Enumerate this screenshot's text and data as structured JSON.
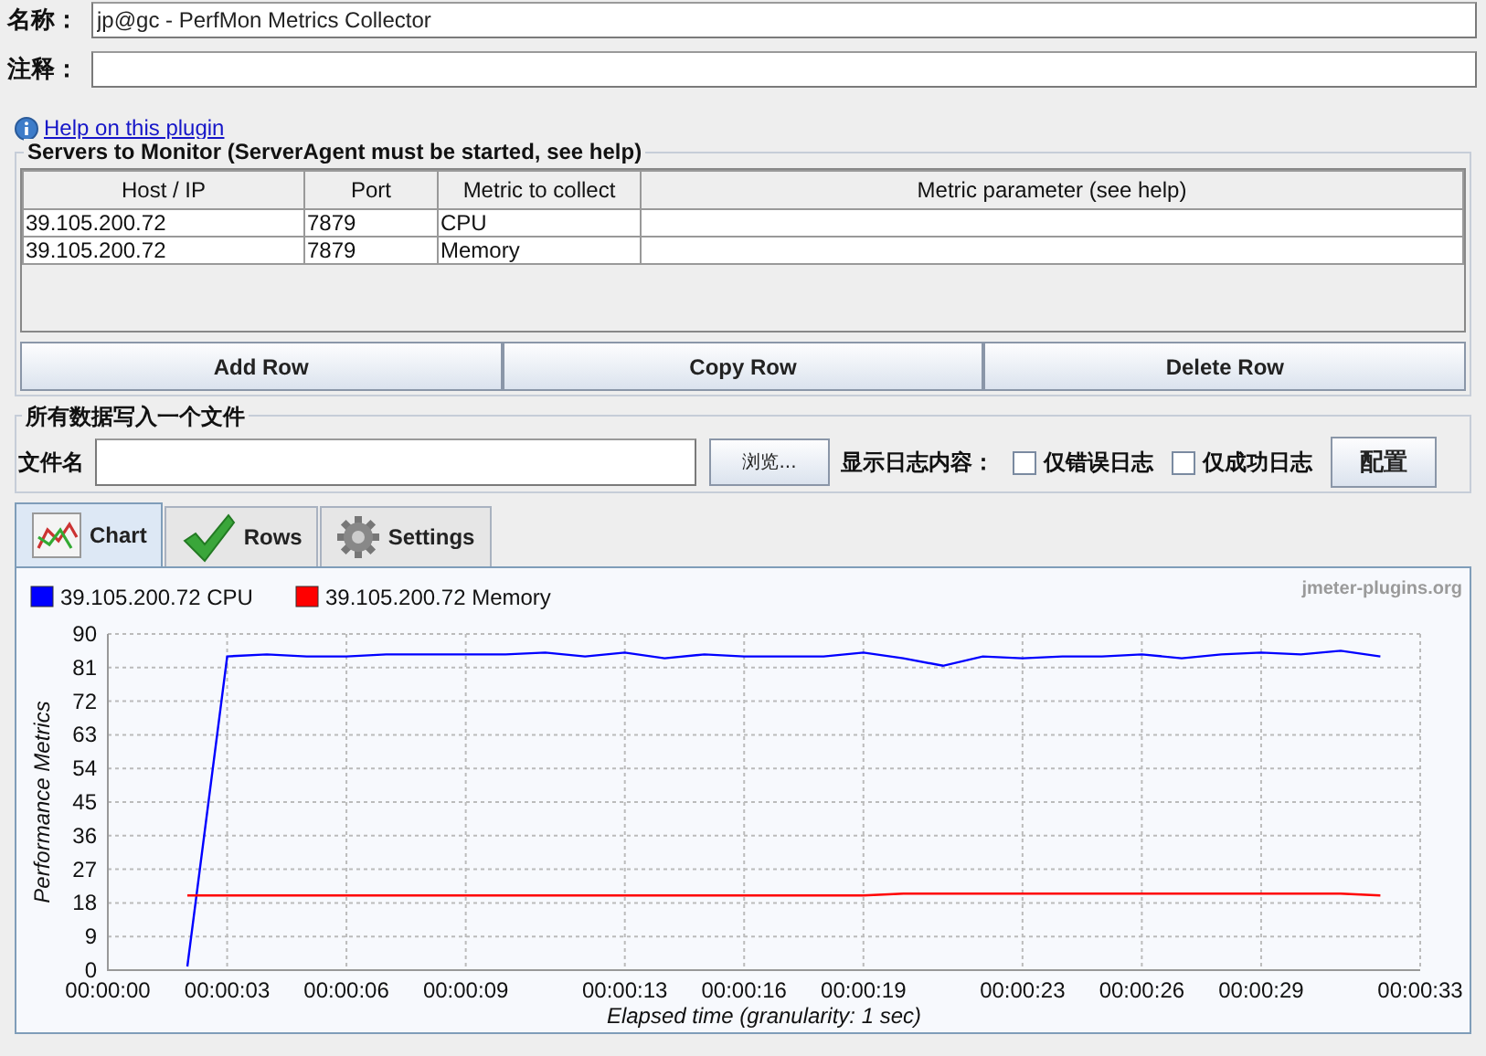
{
  "form": {
    "name_label": "名称：",
    "name_value": "jp@gc - PerfMon Metrics Collector",
    "comment_label": "注释："
  },
  "help_link": "Help on this plugin",
  "servers": {
    "title": "Servers to Monitor (ServerAgent must be started, see help)",
    "columns": [
      "Host / IP",
      "Port",
      "Metric to collect",
      "Metric parameter (see help)"
    ],
    "rows": [
      [
        "39.105.200.72",
        "7879",
        "CPU"
      ],
      [
        "39.105.200.72",
        "7879",
        "Memory"
      ]
    ],
    "buttons": [
      "Add Row",
      "Copy Row",
      "Delete Row"
    ]
  },
  "file_output": {
    "title": "所有数据写入一个文件",
    "filename_label": "文件名",
    "browse_button": "浏览...",
    "log_label": "显示日志内容：",
    "checkboxes": [
      {
        "label": "仅错误日志",
        "checked": false
      },
      {
        "label": "仅成功日志",
        "checked": false
      }
    ],
    "config_button": "配置"
  },
  "tabs": [
    {
      "label": "Chart",
      "kind": "chart",
      "selected": true
    },
    {
      "label": "Rows",
      "kind": "check",
      "selected": false
    },
    {
      "label": "Settings",
      "kind": "gear",
      "selected": false
    }
  ],
  "chart": {
    "watermark": "jmeter-plugins.org",
    "chart_data": {
      "type": "line",
      "xlabel": "Elapsed time (granularity: 1 sec)",
      "ylabel": "Performance Metrics",
      "x": [
        2,
        3,
        4,
        5,
        6,
        7,
        8,
        9,
        10,
        11,
        12,
        13,
        14,
        15,
        16,
        17,
        18,
        19,
        20,
        21,
        22,
        23,
        24,
        25,
        26,
        27,
        28,
        29,
        30,
        31,
        32
      ],
      "series": [
        {
          "name": "39.105.200.72 CPU",
          "color": "#0000ff",
          "values": [
            1,
            84,
            84.5,
            84,
            84,
            84.5,
            84.5,
            84.5,
            84.5,
            85,
            84,
            85,
            83.5,
            84.5,
            84,
            84,
            84,
            85,
            83.5,
            81.5,
            84,
            83.5,
            84,
            84,
            84.5,
            83.5,
            84.5,
            85,
            84.5,
            85.5,
            84
          ]
        },
        {
          "name": "39.105.200.72 Memory",
          "color": "#ff0000",
          "values": [
            20,
            20,
            20,
            20,
            20,
            20,
            20,
            20,
            20,
            20,
            20,
            20,
            20,
            20,
            20,
            20,
            20,
            20,
            20.5,
            20.5,
            20.5,
            20.5,
            20.5,
            20.5,
            20.5,
            20.5,
            20.5,
            20.5,
            20.5,
            20.5,
            20
          ]
        }
      ],
      "xlim": [
        0,
        33
      ],
      "ylim": [
        0,
        90
      ],
      "grid": true,
      "legend": true,
      "xticks": [
        {
          "value": 0,
          "label": "00:00:00"
        },
        {
          "value": 3,
          "label": "00:00:03"
        },
        {
          "value": 6,
          "label": "00:00:06"
        },
        {
          "value": 9,
          "label": "00:00:09"
        },
        {
          "value": 13,
          "label": "00:00:13"
        },
        {
          "value": 16,
          "label": "00:00:16"
        },
        {
          "value": 19,
          "label": "00:00:19"
        },
        {
          "value": 23,
          "label": "00:00:23"
        },
        {
          "value": 26,
          "label": "00:00:26"
        },
        {
          "value": 29,
          "label": "00:00:29"
        },
        {
          "value": 33,
          "label": "00:00:33"
        }
      ],
      "yticks": [
        0,
        9,
        18,
        27,
        36,
        45,
        54,
        63,
        72,
        81,
        90
      ]
    }
  }
}
